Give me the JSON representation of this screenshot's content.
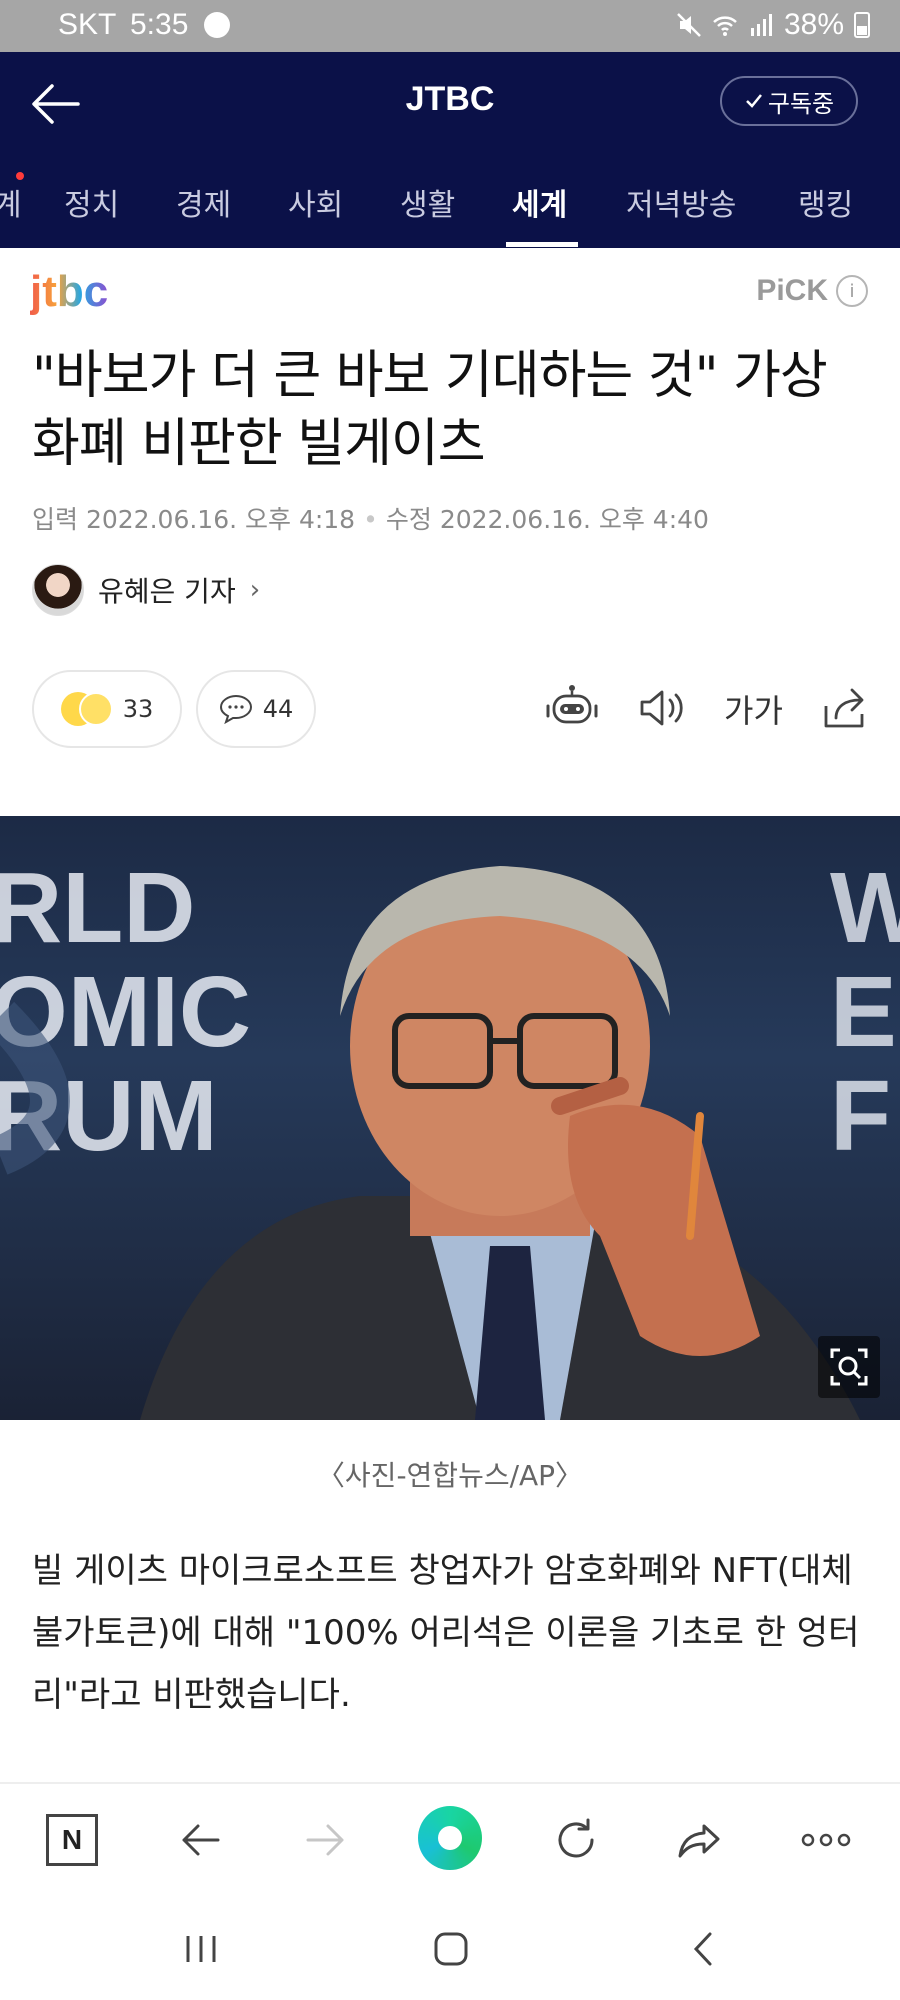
{
  "status_bar": {
    "carrier": "SKT",
    "time": "5:35",
    "battery": "38%"
  },
  "header": {
    "title": "JTBC",
    "subscribe_label": "구독중"
  },
  "tabs": [
    {
      "label": "정치"
    },
    {
      "label": "경제"
    },
    {
      "label": "사회"
    },
    {
      "label": "생활"
    },
    {
      "label": "세계",
      "active": true
    },
    {
      "label": "저녁방송"
    },
    {
      "label": "랭킹"
    }
  ],
  "tab_partial": "계",
  "article": {
    "press_logo_text": "jtbc",
    "pick_label": "PiCK",
    "title": "\"바보가 더 큰 바보 기대하는 것\" 가상화폐 비판한 빌게이츠",
    "input_label": "입력",
    "input_date": "2022.06.16. 오후 4:18",
    "edit_label": "수정",
    "edit_date": "2022.06.16. 오후 4:40",
    "reporter": "유혜은 기자",
    "reaction_count": "33",
    "comment_count": "44",
    "font_tool_label": "가가",
    "photo_text_left": "RLD\nOMIC\nRUM",
    "photo_text_right": "W\nEC\nF",
    "caption": "〈사진-연합뉴스/AP〉",
    "body": "빌 게이츠 마이크로소프트 창업자가 암호화폐와 NFT(대체불가토큰)에 대해 \"100% 어리석은 이론을 기초로 한 엉터리\"라고 비판했습니다."
  },
  "browser_bar": {
    "n_label": "N"
  },
  "colors": {
    "header_bg": "#0b1148",
    "status_bg": "#a6a6a6",
    "accent_green": "#1ec96f"
  }
}
